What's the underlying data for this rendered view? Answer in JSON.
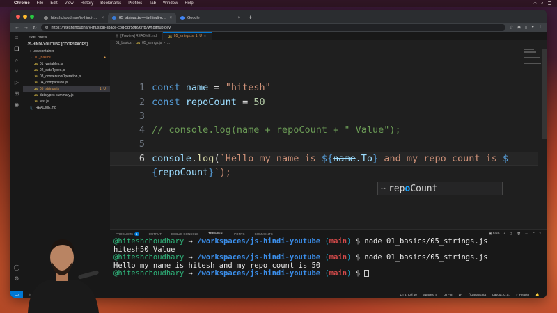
{
  "menubar": {
    "app": "Chrome",
    "items": [
      "File",
      "Edit",
      "View",
      "History",
      "Bookmarks",
      "Profiles",
      "Tab",
      "Window",
      "Help"
    ]
  },
  "browser": {
    "tabs": [
      {
        "label": "hiteshchoudhary/js-hindi-yout",
        "active": false
      },
      {
        "label": "05_strings.js — js-hindi-youtu",
        "active": true
      },
      {
        "label": "Google",
        "active": false
      }
    ],
    "url": "https://hiteshchoudhary-musical-space-cod-5gr59p96rfp7wr.github.dev"
  },
  "sidebar": {
    "title": "EXPLORER",
    "root": "JS-HINDI-YOUTUBE [CODESPACES]",
    "items": [
      {
        "label": ".devcontainer",
        "type": "folder",
        "level": 1
      },
      {
        "label": "01_basics",
        "type": "folder-open",
        "level": 1
      },
      {
        "label": "01_variables.js",
        "type": "js",
        "level": 2
      },
      {
        "label": "02_dataTypes.js",
        "type": "js",
        "level": 2
      },
      {
        "label": "03_conversionOperation.js",
        "type": "js",
        "level": 2
      },
      {
        "label": "04_comparision.js",
        "type": "js",
        "level": 2
      },
      {
        "label": "05_strings.js",
        "type": "js",
        "level": 2,
        "selected": true,
        "badge": "1, U"
      },
      {
        "label": "datatypes-summary.js",
        "type": "js",
        "level": 2
      },
      {
        "label": "test.js",
        "type": "js",
        "level": 2
      },
      {
        "label": "README.md",
        "type": "md",
        "level": 1
      }
    ]
  },
  "editor": {
    "tabs": [
      {
        "label": "[Preview] README.md",
        "active": false
      },
      {
        "label": "05_strings.js",
        "suffix": "1, U",
        "active": true
      }
    ],
    "breadcrumb": [
      "01_basics",
      "05_strings.js",
      "..."
    ],
    "lines": {
      "l1": {
        "num": "1",
        "kw": "const",
        "var": "name",
        "op": " = ",
        "str": "\"hitesh\""
      },
      "l2": {
        "num": "2",
        "kw": "const",
        "var": "repoCount",
        "op": " = ",
        "num_val": "50"
      },
      "l3": {
        "num": "3"
      },
      "l4": {
        "num": "4",
        "comment": "// console.log(name + repoCount + \" Value\");"
      },
      "l5": {
        "num": "5"
      },
      "l6": {
        "num": "6",
        "fn_obj": "console",
        "fn_name": "log",
        "str1": "`Hello my name is ",
        "tmpl_open": "${",
        "strike": "name",
        "partial": ".To",
        "tmpl_close": "}",
        "str2": " and my repo count is ",
        "tmpl2": "$"
      },
      "l6b": {
        "tmpl_open": "{",
        "var": "repoCount",
        "tmpl_close": "}",
        "end": "`);"
      }
    },
    "suggestion": {
      "prefix": "rep",
      "match_hl": "o",
      "rest": "Count",
      "full": "repoCount"
    }
  },
  "panel": {
    "tabs": [
      "PROBLEMS",
      "OUTPUT",
      "DEBUG CONSOLE",
      "TERMINAL",
      "PORTS",
      "COMMENTS"
    ],
    "problems_count": "1",
    "active_tab": "TERMINAL",
    "shell": "bash",
    "terminal": {
      "user": "@hiteshchoudhary",
      "arrow": " → ",
      "path": "/workspaces/js-hindi-youtube",
      "branch": "main",
      "cmd1": "node 01_basics/05_strings.js",
      "out1": "hitesh50 Value",
      "cmd2": "node 01_basics/05_strings.js",
      "out2": "Hello my name is hitesh and my repo count is 50"
    }
  },
  "statusbar": {
    "remote": "Co",
    "warnings": "0",
    "position": "Ln 6, Col 40",
    "spaces": "Spaces: 4",
    "encoding": "UTF-8",
    "eol": "LF",
    "language": "{} JavaScript",
    "layout": "Layout: U.S.",
    "prettier": "✓ Prettier"
  },
  "colors": {
    "accent": "#0078d4",
    "keyword": "#569cd6",
    "variable": "#9cdcfe",
    "string": "#ce9178",
    "comment": "#6a9955"
  }
}
